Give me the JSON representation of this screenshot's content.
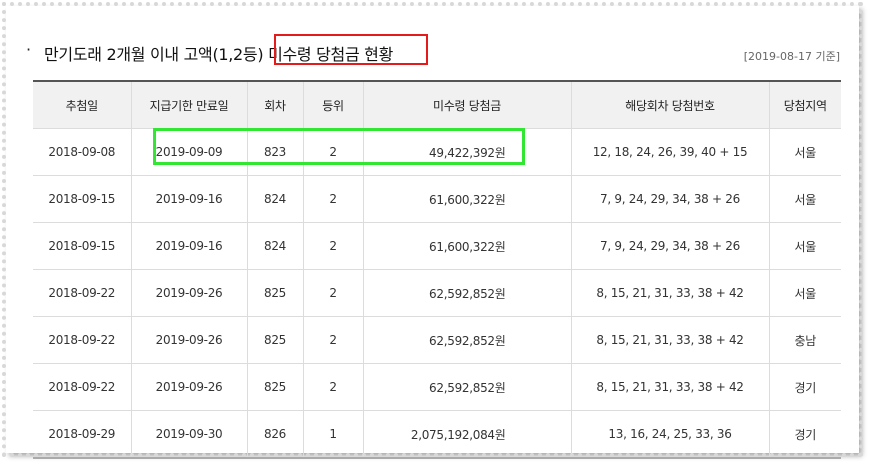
{
  "header": {
    "bullet": "·",
    "title_prefix": "만기도래 2개월 이내 고액(1,2등) ",
    "title_highlight": "미수령 당첨금 현황",
    "date": "[2019-08-17 기준]"
  },
  "table": {
    "columns": [
      "추첨일",
      "지급기한 만료일",
      "회차",
      "등위",
      "미수령 당첨금",
      "해당회차 당첨번호",
      "당첨지역"
    ],
    "rows": [
      [
        "2018-09-08",
        "2019-09-09",
        "823",
        "2",
        "49,422,392원",
        "12, 18, 24, 26, 39, 40 + 15",
        "서울"
      ],
      [
        "2018-09-15",
        "2019-09-16",
        "824",
        "2",
        "61,600,322원",
        "7, 9, 24, 29, 34, 38 + 26",
        "서울"
      ],
      [
        "2018-09-15",
        "2019-09-16",
        "824",
        "2",
        "61,600,322원",
        "7, 9, 24, 29, 34, 38 + 26",
        "서울"
      ],
      [
        "2018-09-22",
        "2019-09-26",
        "825",
        "2",
        "62,592,852원",
        "8, 15, 21, 31, 33, 38 + 42",
        "서울"
      ],
      [
        "2018-09-22",
        "2019-09-26",
        "825",
        "2",
        "62,592,852원",
        "8, 15, 21, 31, 33, 38 + 42",
        "충남"
      ],
      [
        "2018-09-22",
        "2019-09-26",
        "825",
        "2",
        "62,592,852원",
        "8, 15, 21, 31, 33, 38 + 42",
        "경기"
      ],
      [
        "2018-09-29",
        "2019-09-30",
        "826",
        "1",
        "2,075,192,084원",
        "13, 16, 24, 25, 33, 36",
        "경기"
      ]
    ]
  },
  "colors": {
    "highlight_red": "#e41b1b",
    "highlight_green": "#33e633",
    "header_bg": "#f1f1f1"
  }
}
